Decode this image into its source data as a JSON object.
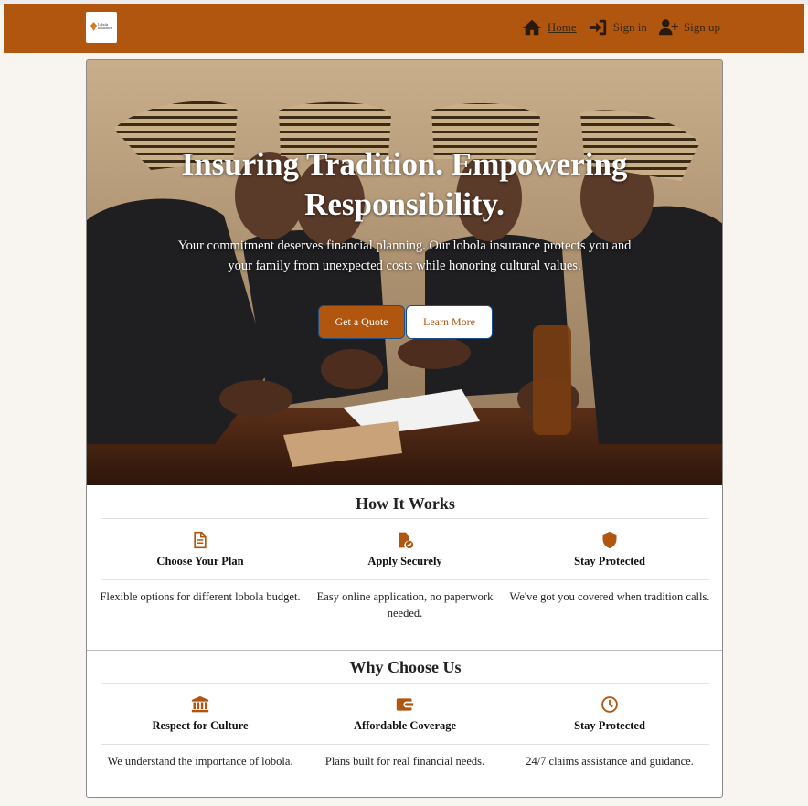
{
  "brand": {
    "logo_text": "Lobola Insurance"
  },
  "nav": {
    "home": "Home",
    "signin": "Sign in",
    "signup": "Sign up"
  },
  "hero": {
    "title": "Insuring Tradition. Empowering Responsibility.",
    "subtitle": "Your commitment deserves financial planning. Our lobola insurance protects you and your family from unexpected costs while honoring cultural values.",
    "primary_button": "Get a Quote",
    "secondary_button": "Learn More"
  },
  "how_it_works": {
    "title": "How It Works",
    "items": [
      {
        "icon": "document-icon",
        "heading": "Choose Your Plan",
        "desc": "Flexible options for different lobola budget."
      },
      {
        "icon": "file-check-icon",
        "heading": "Apply Securely",
        "desc": "Easy online application, no paperwork needed."
      },
      {
        "icon": "shield-icon",
        "heading": "Stay Protected",
        "desc": "We've got you covered when tradition calls."
      }
    ]
  },
  "why_choose_us": {
    "title": "Why Choose Us",
    "items": [
      {
        "icon": "bank-icon",
        "heading": "Respect for Culture",
        "desc": "We understand the importance of lobola."
      },
      {
        "icon": "wallet-icon",
        "heading": "Affordable Coverage",
        "desc": "Plans built for real financial needs."
      },
      {
        "icon": "clock-icon",
        "heading": "Stay Protected",
        "desc": "24/7 claims assistance and guidance."
      }
    ]
  },
  "colors": {
    "brand": "#b0560f",
    "background": "#f8f5f1"
  }
}
